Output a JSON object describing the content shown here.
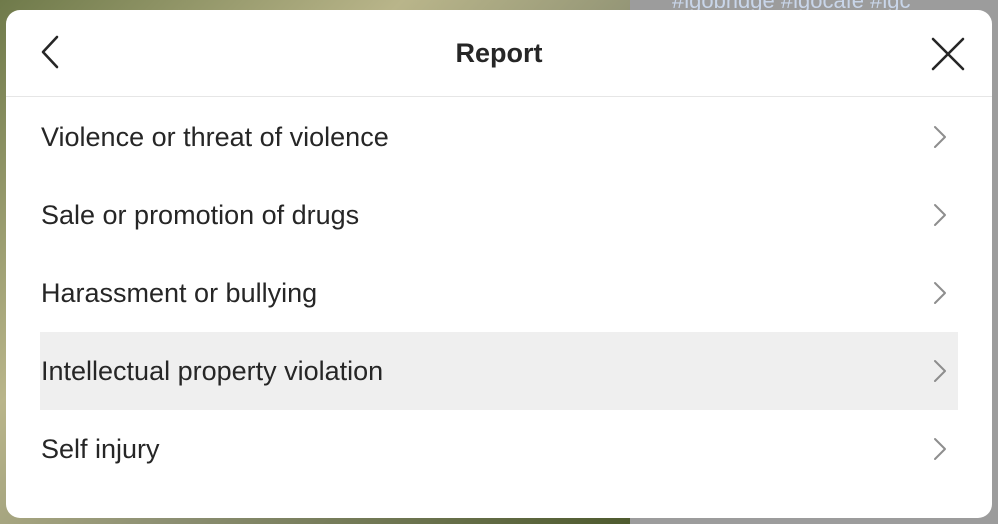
{
  "background": {
    "side_text": "#igobridge #igocafe #igc"
  },
  "dialog": {
    "title": "Report",
    "back_icon": "chevron-left-icon",
    "close_icon": "close-icon",
    "options": [
      {
        "label": "Violence or threat of violence",
        "highlighted": false
      },
      {
        "label": "Sale or promotion of drugs",
        "highlighted": false
      },
      {
        "label": "Harassment or bullying",
        "highlighted": false
      },
      {
        "label": "Intellectual property violation",
        "highlighted": true
      },
      {
        "label": "Self injury",
        "highlighted": false
      }
    ],
    "option_icon": "chevron-right-icon"
  },
  "colors": {
    "text": "#262626",
    "highlight_bg": "#efefef",
    "divider": "#e6e6e6",
    "chevron": "#8e8e8e"
  }
}
